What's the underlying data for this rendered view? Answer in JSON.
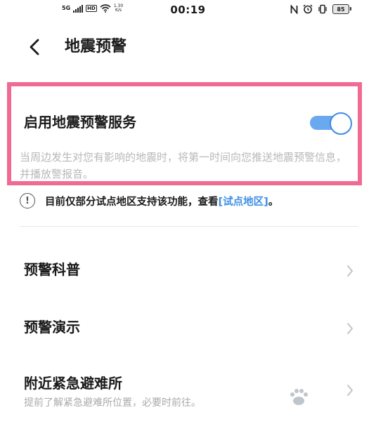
{
  "status_bar": {
    "network": "5G",
    "hd": "HD",
    "speed_value": "1.30",
    "speed_unit": "K/s",
    "time": "00:19",
    "battery": "85"
  },
  "header": {
    "title": "地震预警"
  },
  "service": {
    "label": "启用地震预警服务",
    "enabled": true,
    "description": "当周边发生对您有影响的地震时，将第一时间向您推送地震预警信息，并播放警报音。"
  },
  "notice": {
    "text": "目前仅部分试点地区支持该功能，查看",
    "link": "[试点地区]",
    "suffix": "。"
  },
  "menu": [
    {
      "label": "预警科普"
    },
    {
      "label": "预警演示"
    },
    {
      "label": "附近紧急避难所",
      "subtitle": "提前了解紧急避难所位置，必要时前往。"
    }
  ],
  "colors": {
    "highlight_border": "#f06a93",
    "toggle_on": "#3f8ae6",
    "link": "#3d8fe5"
  },
  "icons": {
    "back": "chevron-left-icon",
    "info": "info-circle-icon",
    "row": "chevron-right-icon"
  }
}
